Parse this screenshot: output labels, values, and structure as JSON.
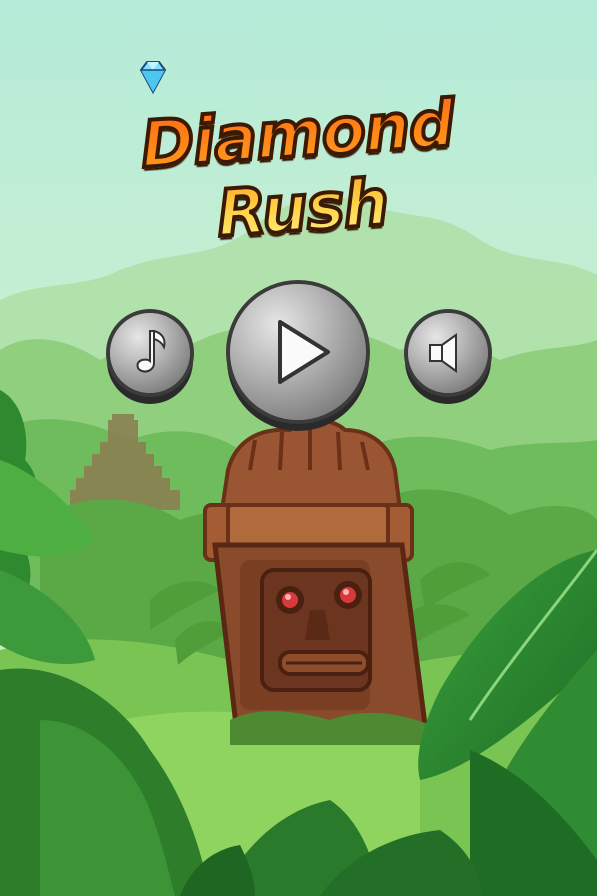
{
  "game": {
    "title": "Diamond Rush"
  },
  "menu": {
    "music_icon": "music-note-icon",
    "play_icon": "play-icon",
    "sound_icon": "speaker-icon"
  },
  "colors": {
    "sky_top": "#b5ecd9",
    "sky_bottom": "#d8f0c7",
    "foliage_dark": "#2f7a2c",
    "foliage_mid": "#58a83c",
    "foliage_light": "#8fcd63",
    "totem": "#8a4a2c",
    "totem_eyes": "#d73a3a",
    "logo_orange": "#ff7a14",
    "logo_yellow": "#ffe56a",
    "button_grey": "#9a9a9a"
  }
}
